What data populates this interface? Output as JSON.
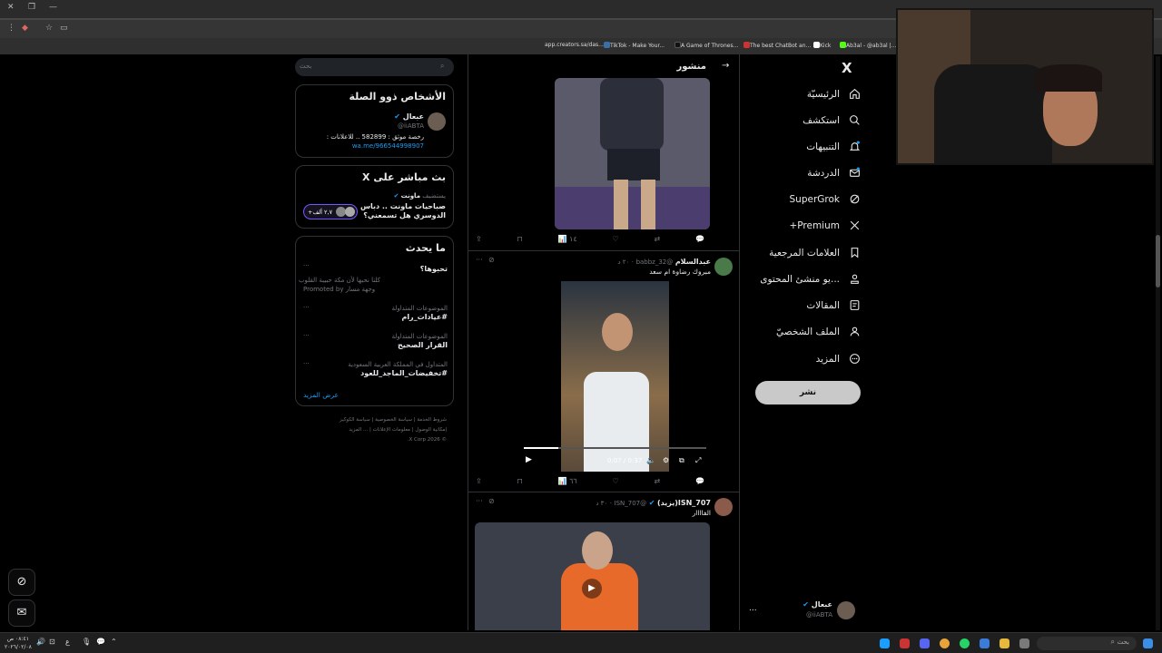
{
  "browser": {
    "bookmarks": [
      {
        "label": "app.creators.sa/das...",
        "color": "#3a6ea5"
      },
      {
        "label": "TikTok - Make Your...",
        "color": "#111111"
      },
      {
        "label": "A Game of Thrones...",
        "color": "#cc3333"
      },
      {
        "label": "The best ChatBot an...",
        "color": "#ffffff"
      },
      {
        "label": "Kick",
        "color": "#53fc18"
      },
      {
        "label": "Ab3al - @ab3al |...",
        "color": "#888888"
      }
    ]
  },
  "sidebar": {
    "logo": "X",
    "items": [
      {
        "label": "الرئيسيّة",
        "icon": "home-icon"
      },
      {
        "label": "استكشف",
        "icon": "search-icon"
      },
      {
        "label": "التنبيهات",
        "icon": "bell-icon"
      },
      {
        "label": "الدردشة",
        "icon": "mail-icon"
      },
      {
        "label": "SuperGrok",
        "icon": "grok-icon"
      },
      {
        "label": "Premium+",
        "icon": "x-icon"
      },
      {
        "label": "العلامات المرجعية",
        "icon": "bookmark-icon"
      },
      {
        "label": "...يو منشئ المحتوى",
        "icon": "creator-icon"
      },
      {
        "label": "المقالات",
        "icon": "article-icon"
      },
      {
        "label": "الملف الشخصيّ",
        "icon": "profile-icon"
      },
      {
        "label": "المزيد",
        "icon": "more-icon"
      }
    ],
    "post_button": "نشر",
    "account": {
      "name": "عبعال",
      "handle": "@iiABTA",
      "more": "..."
    }
  },
  "feed": {
    "header_title": "منشور",
    "tweet1": {
      "views": "١٤"
    },
    "tweet2": {
      "name": "عبدالسلام",
      "handle": "@babbz_32",
      "time": "٢٠ د",
      "text": "مبروك رضاوة ام سعد",
      "video_time": "0:07 / 0:37",
      "views": "٦٦"
    },
    "tweet3": {
      "name": "ISN_707(يزيد)",
      "handle": "@ISN_707",
      "time": "٣٠ د",
      "text": "الفاااار"
    }
  },
  "right": {
    "search_placeholder": "بحث",
    "related": {
      "title": "الأشخاص ذوو الصلة",
      "name": "عبعال",
      "handle": "@iiABTA",
      "bio": "رخصة موثق : 582899 .. للاعلانات :",
      "link": "wa.me/966544998907"
    },
    "live": {
      "title": "X بث مباشر على",
      "host_prefix": "يستضيف",
      "host": "ماونت",
      "text": "صباحيات ماونت .. دباس الدوسري هل تسمعني؟",
      "count": "+٢,٧ ألف"
    },
    "trends": {
      "title": "ما يحدث",
      "items": [
        {
          "meta": "",
          "title": "تحبوها؟",
          "sub": "كلنا نحبها لأن مكة حبيبة القلوب",
          "promo": "Promoted by وجهة مسار"
        },
        {
          "meta": "الموضوعات المتداولة",
          "title": "#عيادات_رام"
        },
        {
          "meta": "الموضوعات المتداولة",
          "title": "القرار الصحيح"
        },
        {
          "meta": "المتداول في المملكة العربية السعودية",
          "title": "#تخفيضات_الماجد_للعود"
        }
      ],
      "show_more": "عرض المزيد"
    },
    "footer": [
      "شروط الخدمة",
      "سياسة الخصوصية",
      "سياسة الكوكيز",
      "إمكانية الوصول",
      "معلومات الإعلانات",
      "... المزيد",
      "© 2026 X Corp."
    ]
  },
  "taskbar": {
    "search": "بحث",
    "time": "٠٨:٤١ ص",
    "date": "٢٠٢٦/٠٢/٠٨"
  },
  "colors": {
    "accent": "#1d9bf0",
    "border": "#2f3336",
    "muted": "#71767b"
  }
}
